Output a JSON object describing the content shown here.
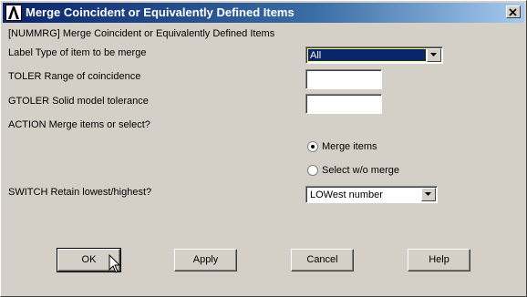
{
  "window": {
    "title": "Merge Coincident or Equivalently Defined Items"
  },
  "header": {
    "command": "[NUMMRG]  Merge Coincident or Equivalently Defined Items"
  },
  "fields": {
    "label_caption": "Label   Type of item to be merge",
    "label_value": "All",
    "toler_caption": "TOLER   Range of coincidence",
    "toler_value": "",
    "gtoler_caption": "GTOLER  Solid model tolerance",
    "gtoler_value": "",
    "action_caption": "ACTION  Merge items or select?",
    "switch_caption": "SWITCH  Retain lowest/highest?",
    "switch_value": "LOWest number"
  },
  "action_options": [
    {
      "label": "Merge items",
      "checked": true
    },
    {
      "label": "Select w/o merge",
      "checked": false
    }
  ],
  "buttons": {
    "ok": "OK",
    "apply": "Apply",
    "cancel": "Cancel",
    "help": "Help"
  }
}
